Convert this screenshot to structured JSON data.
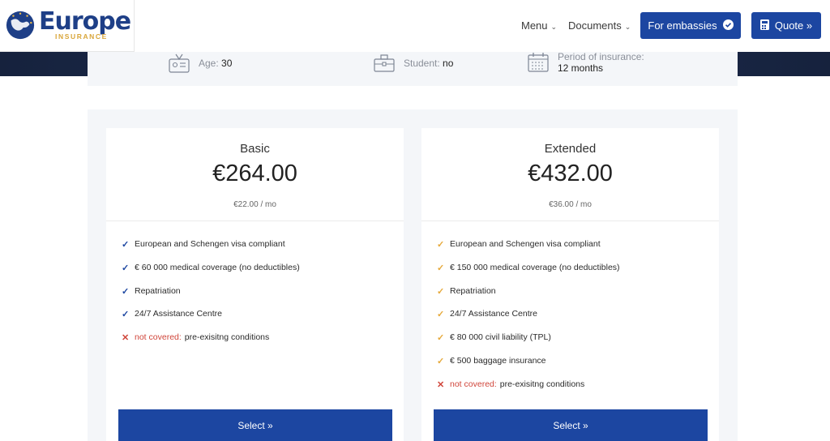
{
  "brand": {
    "name": "Europe",
    "tagline": "INSURANCE"
  },
  "nav": {
    "menu": "Menu",
    "documents": "Documents",
    "embassies": "For embassies",
    "quote": "Quote »"
  },
  "summary": {
    "age_label": "Age: ",
    "age_value": "30",
    "student_label": "Student: ",
    "student_value": "no",
    "period_label": "Period of insurance:",
    "period_value": "12 months"
  },
  "colors": {
    "primary": "#1c46a1",
    "check_basic": "#1c46a1",
    "check_extended": "#e6a93a",
    "not_covered": "#d0453a"
  },
  "plans": [
    {
      "name": "Basic",
      "price": "€264.00",
      "monthly": "€22.00 / mo",
      "features": [
        "European and Schengen visa compliant",
        "€ 60 000 medical coverage (no deductibles)",
        "Repatriation",
        "24/7 Assistance Centre"
      ],
      "not_covered_label": "not covered:",
      "not_covered_text": "pre-exisitng conditions",
      "button": "Select »"
    },
    {
      "name": "Extended",
      "price": "€432.00",
      "monthly": "€36.00 / mo",
      "features": [
        "European and Schengen visa compliant",
        "€ 150 000 medical coverage (no deductibles)",
        "Repatriation",
        "24/7 Assistance Centre",
        "€ 80 000 civil liability (TPL)",
        "€ 500 baggage insurance"
      ],
      "not_covered_label": "not covered:",
      "not_covered_text": "pre-exisitng conditions",
      "button": "Select »"
    }
  ]
}
